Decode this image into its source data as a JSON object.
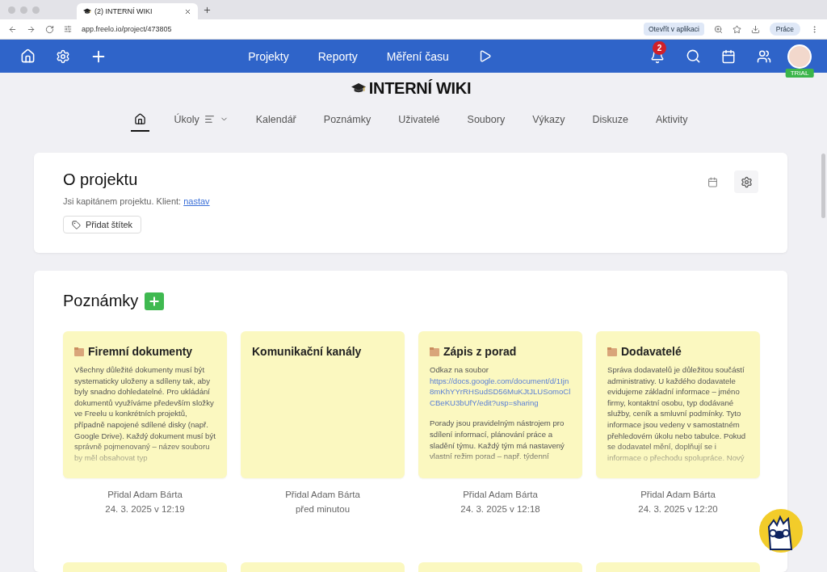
{
  "browser": {
    "tab_title": "(2) INTERNÍ WIKI",
    "url": "app.freelo.io/project/473805",
    "open_in_app": "Otevřít v aplikaci",
    "profile": "Práce"
  },
  "header": {
    "nav": [
      "Projekty",
      "Reporty",
      "Měření času"
    ],
    "notifications": "2",
    "avatar_badge": "TRIAL"
  },
  "project_title": "INTERNÍ WIKI",
  "tabs": [
    {
      "kind": "home",
      "selected": true
    },
    {
      "kind": "menu",
      "label": "Úkoly",
      "selected": false
    },
    {
      "kind": "text",
      "label": "Kalendář",
      "selected": false
    },
    {
      "kind": "text",
      "label": "Poznámky",
      "selected": false
    },
    {
      "kind": "text",
      "label": "Uživatelé",
      "selected": false
    },
    {
      "kind": "text",
      "label": "Soubory",
      "selected": false
    },
    {
      "kind": "text",
      "label": "Výkazy",
      "selected": false
    },
    {
      "kind": "text",
      "label": "Diskuze",
      "selected": false
    },
    {
      "kind": "text",
      "label": "Aktivity",
      "selected": false
    }
  ],
  "about": {
    "title": "O projektu",
    "text": "Jsi kapitánem projektu. Klient:",
    "link": "nastav",
    "tag_button": "Přidat štítek"
  },
  "notes": {
    "title": "Poznámky",
    "items": [
      {
        "title": "Firemní dokumenty",
        "has_icon": true,
        "body": "Všechny důležité dokumenty musí být systematicky uloženy a sdíleny tak, aby byly snadno dohledatelné. Pro ukládání dokumentů využíváme především složky ve Freelu u konkrétních projektů, případně napojené sdílené disky (např. Google Drive). Každý dokument musí být správně pojmenovaný – název souboru by měl obsahovat typ",
        "author": "Přidal Adam Bárta",
        "date": "24. 3. 2025 v 12:19"
      },
      {
        "title": "Komunikační kanály",
        "has_icon": false,
        "author": "Přidal Adam Bárta",
        "date": "před minutou"
      },
      {
        "title": "Zápis z porad",
        "has_icon": true,
        "intro": "Odkaz na soubor",
        "link": "https://docs.google.com/document/d/1Ijn8mKhYYrRHSudSD56MuKJtJLUSomoClCBeKU3bUfY/edit?usp=sharing",
        "body": "Porady jsou pravidelným nástrojem pro sdílení informací, plánování práce a sladění týmu. Každý tým má nastavený vlastní režim porad – např. týdenní",
        "author": "Přidal Adam Bárta",
        "date": "24. 3. 2025 v 12:18"
      },
      {
        "title": "Dodavatelé",
        "has_icon": true,
        "body": "Správa dodavatelů je důležitou součástí administrativy. U každého dodavatele evidujeme základní informace – jméno firmy, kontaktní osobu, typ dodávané služby, ceník a smluvní podmínky. Tyto informace jsou vedeny v samostatném přehledovém úkolu nebo tabulce. Pokud se dodavatel mění, doplňují se i informace o přechodu spolupráce. Nový",
        "author": "Přidal Adam Bárta",
        "date": "24. 3. 2025 v 12:20"
      }
    ]
  }
}
